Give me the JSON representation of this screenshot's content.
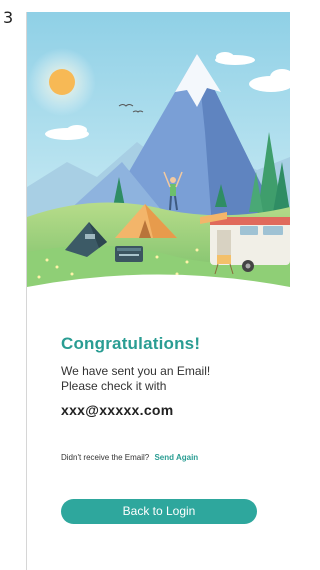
{
  "step_number": "3",
  "illustration": {
    "description_icon": "camping-scene-illustration"
  },
  "confirmation": {
    "title": "Congratulations!",
    "message_line1": "We have sent you an Email!",
    "message_line2": "Please check it with",
    "email": "xxx@xxxxx.com"
  },
  "resend": {
    "prompt": "Didn't receive the Email?",
    "link_label": "Send Again"
  },
  "login_button": {
    "label": "Back to Login"
  },
  "colors": {
    "accent": "#2a9d93",
    "button": "#2ea79d",
    "text": "#333333"
  }
}
